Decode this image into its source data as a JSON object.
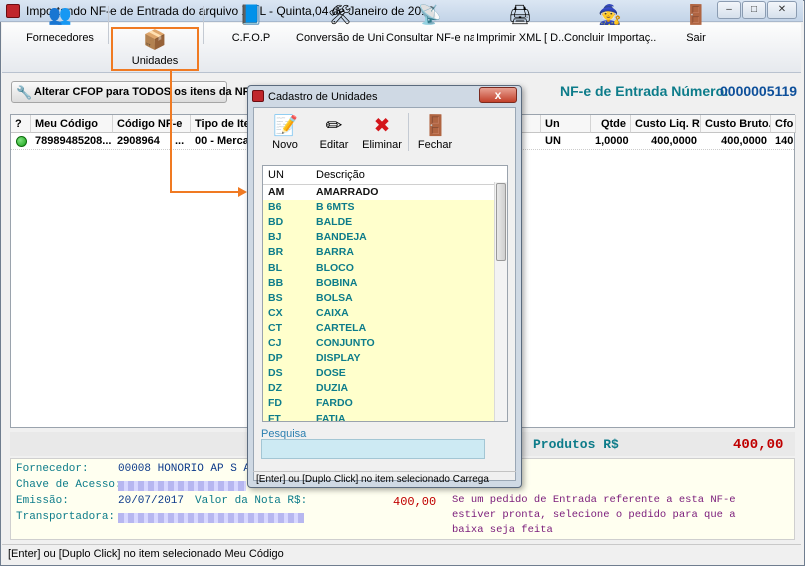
{
  "window": {
    "title": "Importando NF-e de Entrada do arquivo XML - Quinta,04 de Janeiro de 2018",
    "min": "‒",
    "max": "□",
    "close": "✕"
  },
  "toolbar": {
    "items": [
      {
        "label": "Fornecedores",
        "icon": "users-icon",
        "glyph": "👥"
      },
      {
        "label": "Unidades",
        "icon": "boxes-icon",
        "glyph": "📦"
      },
      {
        "label": "C.F.O.P",
        "icon": "book-icon",
        "glyph": "📘"
      },
      {
        "label": "Conversão de Uni...",
        "icon": "tools-icon",
        "glyph": "🛠"
      },
      {
        "label": "Consultar NF-e na...",
        "icon": "satellite-icon",
        "glyph": "📡"
      },
      {
        "label": "Imprimir XML [ D...",
        "icon": "printer-icon",
        "glyph": "🖨"
      },
      {
        "label": "Concluir Importaç...",
        "icon": "wizard-icon",
        "glyph": "🧙"
      },
      {
        "label": "Sair",
        "icon": "exit-door-icon",
        "glyph": "🚪"
      }
    ]
  },
  "cfop_button": "Alterar CFOP para TODOS os itens da NFe",
  "nfe": {
    "title": "NF-e de Entrada Número:",
    "number": "0000005119"
  },
  "grid": {
    "headers": [
      "?",
      "Meu Código",
      "Código NF-e",
      "Tipo de Item",
      "Un",
      "Qtde",
      "Custo Liq. R$",
      "Custo Bruto...",
      "Cfo"
    ],
    "row": [
      "",
      "78989485208...",
      "2908964",
      "...",
      "00 - Mercad",
      "UN",
      "1,0000",
      "400,0000",
      "400,0000",
      "140"
    ]
  },
  "totals": {
    "label": "Produtos R$",
    "value": "400,00"
  },
  "info": {
    "fornecedor_label": "Fornecedor:",
    "fornecedor_value": "00008 HONORIO AP S A",
    "chave_label": "Chave de Acesso:",
    "emissao_label": "Emissão:",
    "emissao_value": "20/07/2017",
    "valor_label": "Valor da Nota R$:",
    "valor_value": "400,00",
    "transp_label": "Transportadora:",
    "note": "Se um pedido de Entrada referente a esta NF-e estiver pronta, selecione o pedido para que a baixa seja feita"
  },
  "statusbar": "[Enter] ou [Duplo Click] no item selecionado Meu Código",
  "dialog": {
    "title": "Cadastro de Unidades",
    "close": "x",
    "buttons": [
      {
        "label": "Novo",
        "icon": "notepad-icon",
        "glyph": "📝"
      },
      {
        "label": "Editar",
        "icon": "edit-icon",
        "glyph": "✏"
      },
      {
        "label": "Eliminar",
        "icon": "delete-x-icon",
        "glyph": "✖"
      },
      {
        "label": "Fechar",
        "icon": "exit-door-icon",
        "glyph": "🚪"
      }
    ],
    "list_headers": [
      "UN",
      "Descrição"
    ],
    "rows": [
      [
        "AM",
        "AMARRADO"
      ],
      [
        "B6",
        "B 6MTS"
      ],
      [
        "BD",
        "BALDE"
      ],
      [
        "BJ",
        "BANDEJA"
      ],
      [
        "BR",
        "BARRA"
      ],
      [
        "BL",
        "BLOCO"
      ],
      [
        "BB",
        "BOBINA"
      ],
      [
        "BS",
        "BOLSA"
      ],
      [
        "CX",
        "CAIXA"
      ],
      [
        "CT",
        "CARTELA"
      ],
      [
        "CJ",
        "CONJUNTO"
      ],
      [
        "DP",
        "DISPLAY"
      ],
      [
        "DS",
        "DOSE"
      ],
      [
        "DZ",
        "DUZIA"
      ],
      [
        "FD",
        "FARDO"
      ],
      [
        "FT",
        "FATIA"
      ]
    ],
    "search_label": "Pesquisa",
    "search_value": "",
    "status": "[Enter] ou [Duplo Click] no item selecionado Carrega"
  },
  "colors": {
    "accent_orange": "#f07a22",
    "teal": "#0d7c8a",
    "list_bg": "#ffffcc",
    "total_red": "#c00000"
  }
}
